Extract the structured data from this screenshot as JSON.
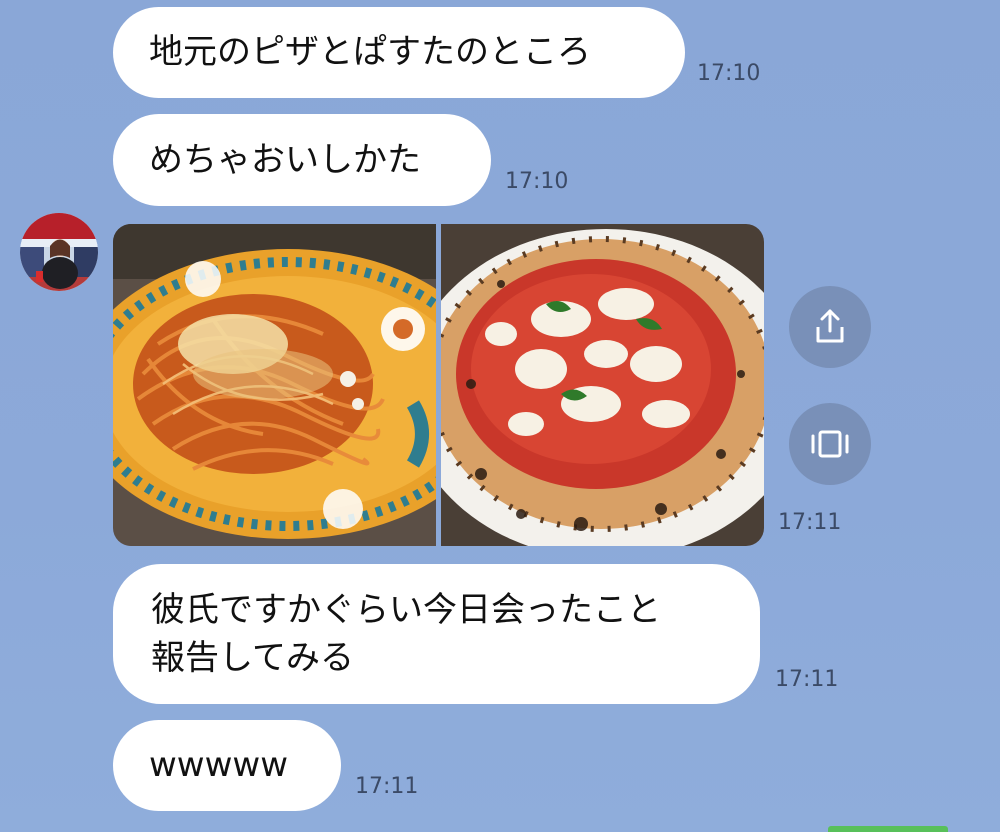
{
  "messages": [
    {
      "text": "地元のピザとぱすたのところ",
      "time": "17:10"
    },
    {
      "text": "めちゃおいしかた",
      "time": "17:10"
    },
    {
      "photo_time": "17:11"
    },
    {
      "text": "彼氏ですかぐらい今日会ったこと\n報告してみる",
      "time": "17:11"
    },
    {
      "text": "wwwww",
      "time": "17:11"
    }
  ],
  "images": [
    {
      "name": "pasta-photo",
      "subject": "spaghetti with tomato sauce on decorated plate"
    },
    {
      "name": "pizza-photo",
      "subject": "margherita pizza"
    }
  ],
  "actions": {
    "share_icon": "share-icon",
    "album_icon": "album-icon"
  },
  "colors": {
    "background": "#8ba8d8",
    "bubble": "#ffffff",
    "button": "#7990b8",
    "accent_tab": "#58c05a"
  }
}
